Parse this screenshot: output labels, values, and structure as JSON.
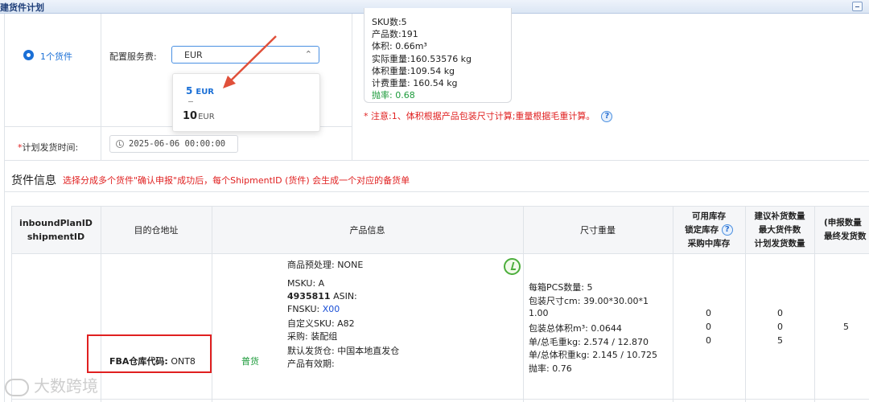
{
  "window": {
    "title": "建货件计划"
  },
  "plan": {
    "radio_label": "1个货件",
    "fee_label": "配置服务费:",
    "fee_value": "EUR",
    "dropdown_options": [
      {
        "num": "5",
        "unit": "EUR",
        "selected": true
      },
      {
        "num": "10",
        "unit": "EUR",
        "selected": false
      }
    ],
    "date_required_mark": "*",
    "date_label": "计划发货时间:",
    "date_value": "2025-06-06 00:00:00"
  },
  "summary": {
    "lines": [
      "SKU数:5",
      "产品数:191",
      "体积: 0.66m³",
      "实际重量:160.53576 kg",
      "体积重量:109.54 kg",
      "计费重量: 160.54 kg"
    ],
    "rate": "抛率: 0.68",
    "note": "* 注意:1、体积根据产品包装尺寸计算;重量根据毛重计算。"
  },
  "shipment": {
    "title": "货件信息",
    "note": "选择分成多个货件\"确认申报\"成功后，每个ShipmentID (货件) 会生成一个对应的备货单"
  },
  "table": {
    "headers": {
      "c1_l1": "inboundPlanID",
      "c1_l2": "shipmentID",
      "c2": "目的仓地址",
      "c3": "产品信息",
      "c4": "尺寸重量",
      "c5_l1": "可用库存",
      "c5_l2": "锁定库存",
      "c5_l3": "采购中库存",
      "c6_l1": "建议补货数量",
      "c6_l2": "最大货件数",
      "c6_l3": "计划发货数量",
      "c7_l1": "(申报数量",
      "c7_l2": "最终发货数"
    },
    "row": {
      "fba_label": "FBA仓库代码:",
      "fba_code": "ONT8",
      "kind": "普货",
      "product": {
        "preprocess": "商品预处理: NONE",
        "msku": "MSKU: A",
        "asin_num": "4935811",
        "asin_label": " ASIN:",
        "fnsku_label": "FNSKU: ",
        "fnsku_value": "X00",
        "custom_sku": "自定义SKU: A82",
        "purchase": "采购: 装配组",
        "warehouse": "默认发货仓: 中国本地直发仓",
        "validity": "产品有效期:"
      },
      "dims": [
        "每箱PCS数量: 5",
        "包装尺寸cm: 39.00*30.00*1",
        "1.00",
        "包装总体积m³: 0.0644",
        "单/总毛重kg: 2.574 / 12.870",
        "单/总体积重kg: 2.145 / 10.725",
        "抛率: 0.76"
      ],
      "stock": [
        "0",
        "0",
        "0"
      ],
      "replenish": [
        "0",
        "0",
        "5"
      ],
      "final": "5"
    }
  },
  "watermark": "大数跨境",
  "colors": {
    "accent": "#1a6fd6",
    "danger": "#e02020",
    "success": "#1e9b3c"
  }
}
